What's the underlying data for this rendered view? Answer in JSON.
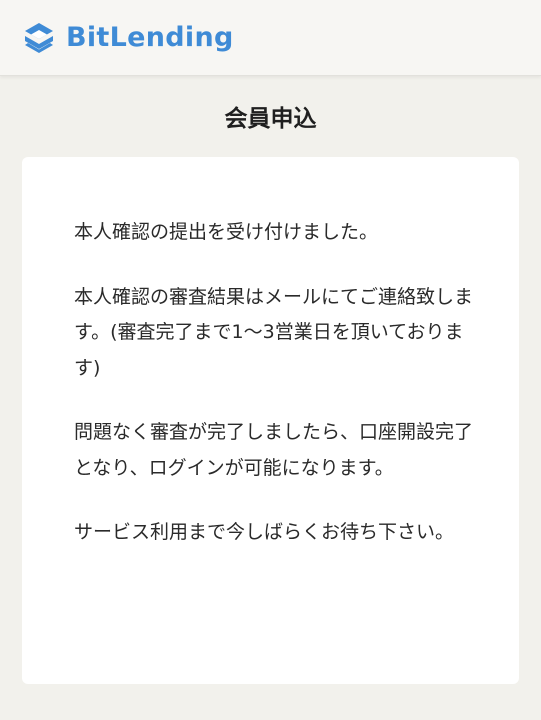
{
  "header": {
    "logo_text": "BitLending",
    "logo_icon": "stacked-layers-logo",
    "brand_color": "#3f8bd6"
  },
  "page": {
    "title": "会員申込"
  },
  "message": {
    "paragraphs": [
      "本人確認の提出を受け付けました。",
      "本人確認の審査結果はメールにてご連絡致します。(審査完了まで1〜3営業日を頂いております)",
      "問題なく審査が完了しましたら、口座開設完了となり、ログインが可能になります。",
      "サービス利用まで今しばらくお待ち下さい。"
    ]
  }
}
